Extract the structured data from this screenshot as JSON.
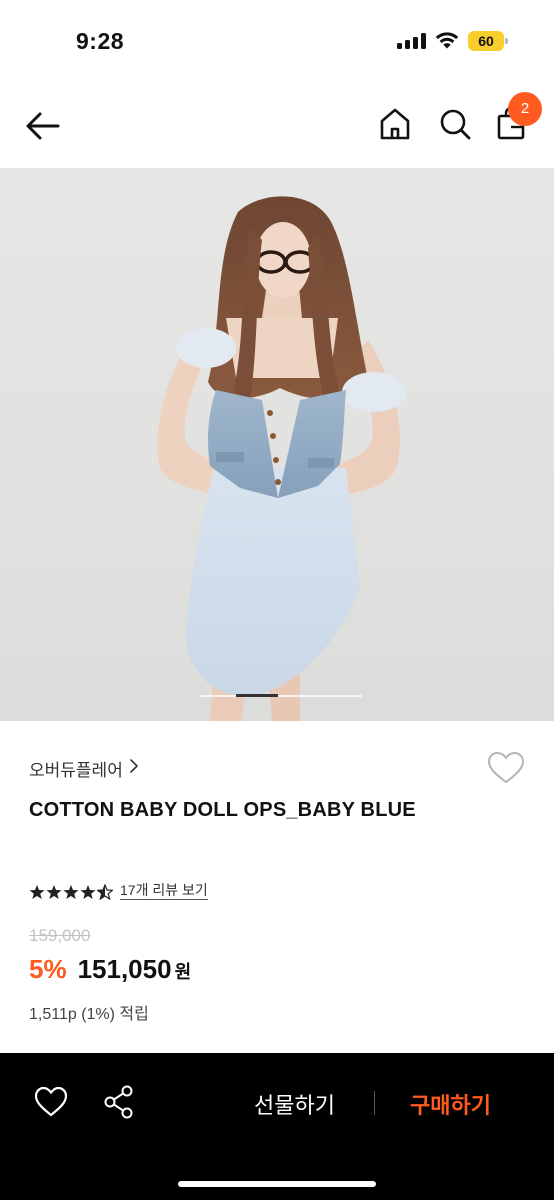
{
  "status_bar": {
    "time": "9:28",
    "battery": "60",
    "icons": [
      "signal-icon",
      "wifi-icon",
      "battery-icon"
    ],
    "battery_color": "#f7ce2b"
  },
  "header": {
    "icons": [
      "back-arrow-icon",
      "home-icon",
      "search-icon",
      "shopping-bag-icon"
    ],
    "cart_count": "2",
    "badge_color": "#ff5a1f"
  },
  "gallery": {
    "carousel_position": 0.22
  },
  "product": {
    "brand": "오버듀플레어",
    "brand_chevron": ">",
    "title": "COTTON BABY DOLL OPS_BABY BLUE",
    "rating": 4.5,
    "review_link": "17개 리뷰 보기",
    "original_price": "159,000",
    "discount_rate": "5%",
    "sale_price": "151,050",
    "currency": "원",
    "points": "1,511p (1%) 적립"
  },
  "bottom_bar": {
    "gift_label": "선물하기",
    "buy_label": "구매하기",
    "icons": [
      "heart-outline-icon",
      "share-icon"
    ],
    "accent_color": "#ff5a1f"
  }
}
